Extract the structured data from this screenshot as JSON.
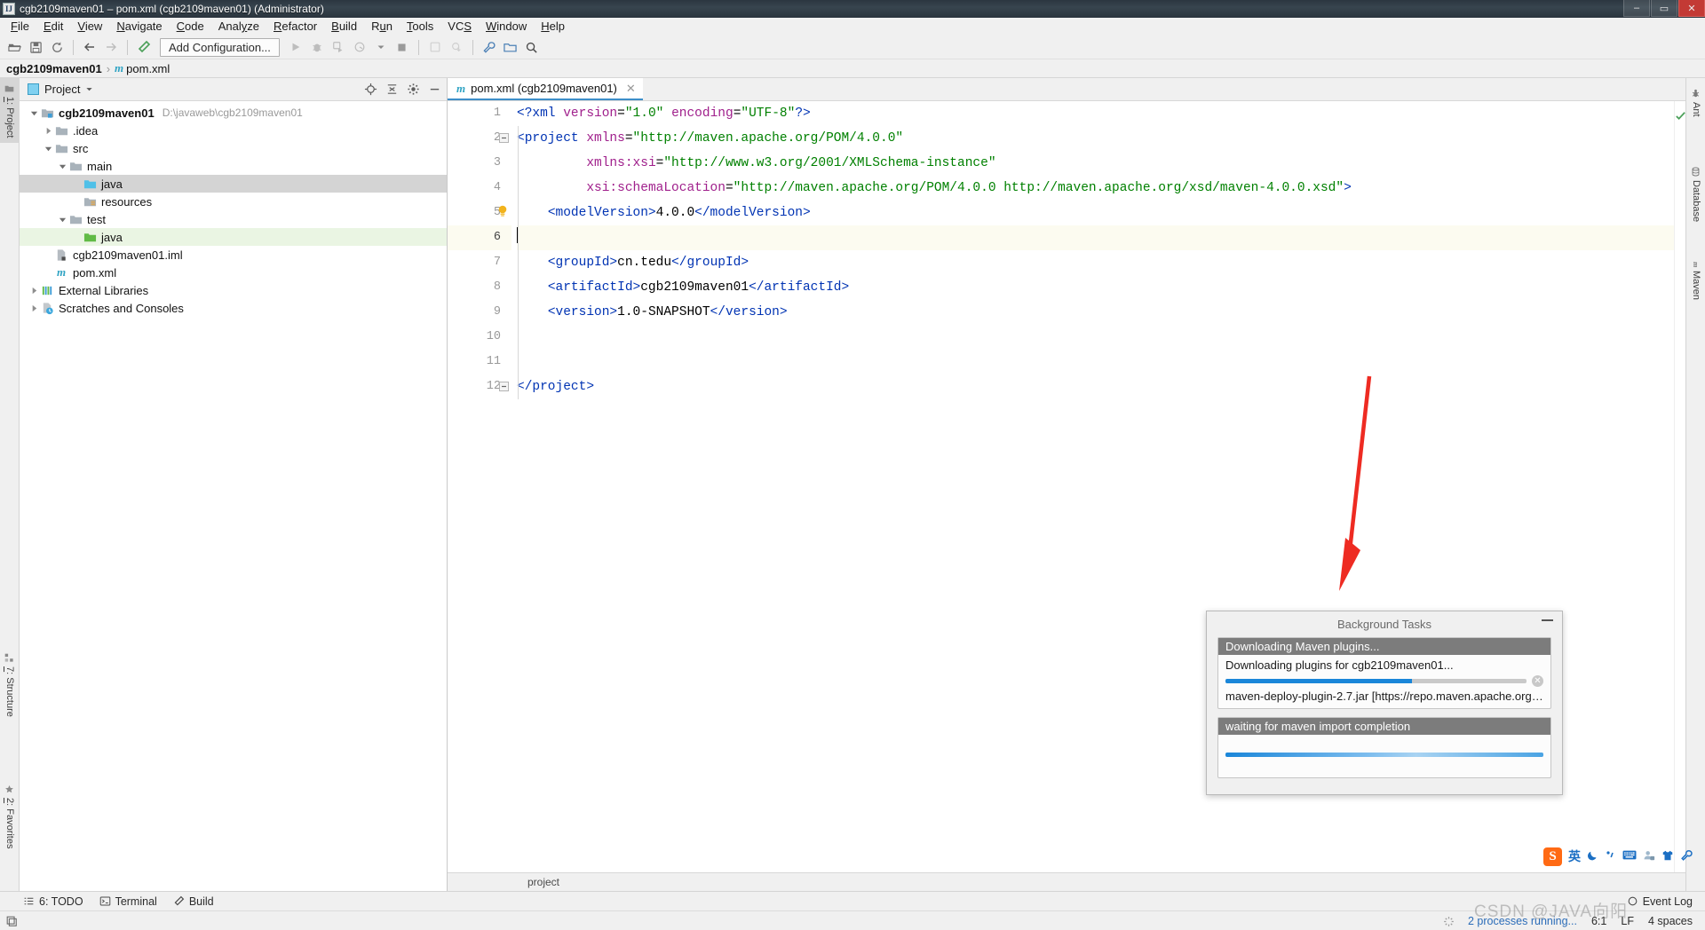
{
  "window": {
    "title": "cgb2109maven01 – pom.xml (cgb2109maven01) (Administrator)",
    "minimize": "–",
    "maximize": "▭",
    "close": "✕"
  },
  "menubar": {
    "items": [
      "File",
      "Edit",
      "View",
      "Navigate",
      "Code",
      "Analyze",
      "Refactor",
      "Build",
      "Run",
      "Tools",
      "VCS",
      "Window",
      "Help"
    ]
  },
  "toolbar": {
    "add_configuration": "Add Configuration...",
    "icons": [
      "open-folder-icon",
      "save-all-icon",
      "sync-icon",
      "back-arrow-icon",
      "forward-arrow-icon",
      "build-hammer-icon",
      "run-icon",
      "debug-icon",
      "run-with-coverage-icon",
      "profile-icon",
      "stop-icon",
      "update-project-icon",
      "commit-icon",
      "settings-wrench-icon",
      "project-structure-icon",
      "search-icon"
    ]
  },
  "navbar": {
    "project": "cgb2109maven01",
    "separator": "›",
    "file_icon": "m",
    "file": "pom.xml"
  },
  "left_tool_strip": {
    "tabs": [
      {
        "label": "1: Project",
        "icon": "project-folder-icon",
        "active": true
      },
      {
        "label": "7: Structure",
        "icon": "structure-icon",
        "active": false
      },
      {
        "label": "2: Favorites",
        "icon": "star-icon",
        "active": false
      }
    ]
  },
  "right_tool_strip": {
    "tabs": [
      {
        "label": "Ant",
        "icon": "ant-icon"
      },
      {
        "label": "Database",
        "icon": "database-icon"
      },
      {
        "label": "Maven",
        "icon": "maven-m-icon"
      }
    ]
  },
  "project_panel": {
    "header_label": "Project",
    "header_icons": [
      "locate-target-icon",
      "collapse-all-icon",
      "settings-gear-icon",
      "hide-minimize-icon"
    ],
    "tree": [
      {
        "label": "cgb2109maven01",
        "path": "D:\\javaweb\\cgb2109maven01",
        "depth": 0,
        "arrow": "down",
        "icon": "module-folder-icon",
        "bold": true,
        "state": "normal"
      },
      {
        "label": ".idea",
        "path": "",
        "depth": 1,
        "arrow": "right",
        "icon": "folder-icon",
        "bold": false,
        "state": "normal"
      },
      {
        "label": "src",
        "path": "",
        "depth": 1,
        "arrow": "down",
        "icon": "folder-icon",
        "bold": false,
        "state": "normal"
      },
      {
        "label": "main",
        "path": "",
        "depth": 2,
        "arrow": "down",
        "icon": "folder-icon",
        "bold": false,
        "state": "normal"
      },
      {
        "label": "java",
        "path": "",
        "depth": 3,
        "arrow": "none",
        "icon": "source-root-folder-icon",
        "bold": false,
        "state": "selected"
      },
      {
        "label": "resources",
        "path": "",
        "depth": 3,
        "arrow": "none",
        "icon": "resources-root-folder-icon",
        "bold": false,
        "state": "normal"
      },
      {
        "label": "test",
        "path": "",
        "depth": 2,
        "arrow": "down",
        "icon": "folder-icon",
        "bold": false,
        "state": "normal"
      },
      {
        "label": "java",
        "path": "",
        "depth": 3,
        "arrow": "none",
        "icon": "test-source-root-folder-icon",
        "bold": false,
        "state": "green"
      },
      {
        "label": "cgb2109maven01.iml",
        "path": "",
        "depth": 1,
        "arrow": "none",
        "icon": "iml-file-icon",
        "bold": false,
        "state": "normal"
      },
      {
        "label": "pom.xml",
        "path": "",
        "depth": 1,
        "arrow": "none",
        "icon": "maven-m-icon",
        "bold": false,
        "state": "normal"
      },
      {
        "label": "External Libraries",
        "path": "",
        "depth": 0,
        "arrow": "right",
        "icon": "libraries-icon",
        "bold": false,
        "state": "normal"
      },
      {
        "label": "Scratches and Consoles",
        "path": "",
        "depth": 0,
        "arrow": "right",
        "icon": "scratches-icon",
        "bold": false,
        "state": "normal"
      }
    ]
  },
  "editor": {
    "tab": {
      "icon": "m",
      "label": "pom.xml (cgb2109maven01)",
      "close": "✕"
    },
    "breadcrumb": "project",
    "cursor_line": 6,
    "line_numbers": [
      "1",
      "2",
      "3",
      "4",
      "5",
      "6",
      "7",
      "8",
      "9",
      "10",
      "11",
      "12"
    ],
    "code_lines": [
      {
        "n": 1,
        "segments": [
          {
            "t": "<?",
            "c": "pi"
          },
          {
            "t": "xml",
            "c": "tagn"
          },
          {
            "t": " ",
            "c": "plain"
          },
          {
            "t": "version",
            "c": "attr"
          },
          {
            "t": "=",
            "c": "plain"
          },
          {
            "t": "\"1.0\"",
            "c": "str"
          },
          {
            "t": " ",
            "c": "plain"
          },
          {
            "t": "encoding",
            "c": "attr"
          },
          {
            "t": "=",
            "c": "plain"
          },
          {
            "t": "\"UTF-8\"",
            "c": "str"
          },
          {
            "t": "?>",
            "c": "pi"
          }
        ]
      },
      {
        "n": 2,
        "segments": [
          {
            "t": "<",
            "c": "pi"
          },
          {
            "t": "project",
            "c": "tagn"
          },
          {
            "t": " ",
            "c": "plain"
          },
          {
            "t": "xmlns",
            "c": "attr"
          },
          {
            "t": "=",
            "c": "plain"
          },
          {
            "t": "\"http://maven.apache.org/POM/4.0.0\"",
            "c": "str"
          }
        ]
      },
      {
        "n": 3,
        "segments": [
          {
            "t": "         ",
            "c": "plain"
          },
          {
            "t": "xmlns:xsi",
            "c": "attr"
          },
          {
            "t": "=",
            "c": "plain"
          },
          {
            "t": "\"http://www.w3.org/2001/XMLSchema-instance\"",
            "c": "str"
          }
        ]
      },
      {
        "n": 4,
        "segments": [
          {
            "t": "         ",
            "c": "plain"
          },
          {
            "t": "xsi:schemaLocation",
            "c": "attr"
          },
          {
            "t": "=",
            "c": "plain"
          },
          {
            "t": "\"http://maven.apache.org/POM/4.0.0 http://maven.apache.org/xsd/maven-4.0.0.xsd\"",
            "c": "str"
          },
          {
            "t": ">",
            "c": "pi"
          }
        ]
      },
      {
        "n": 5,
        "segments": [
          {
            "t": "    ",
            "c": "plain"
          },
          {
            "t": "<modelVersion>",
            "c": "tagn"
          },
          {
            "t": "4.0.0",
            "c": "plain"
          },
          {
            "t": "</modelVersion>",
            "c": "tagn"
          }
        ]
      },
      {
        "n": 6,
        "segments": []
      },
      {
        "n": 7,
        "segments": [
          {
            "t": "    ",
            "c": "plain"
          },
          {
            "t": "<groupId>",
            "c": "tagn"
          },
          {
            "t": "cn.tedu",
            "c": "plain"
          },
          {
            "t": "</groupId>",
            "c": "tagn"
          }
        ]
      },
      {
        "n": 8,
        "segments": [
          {
            "t": "    ",
            "c": "plain"
          },
          {
            "t": "<artifactId>",
            "c": "tagn"
          },
          {
            "t": "cgb2109maven01",
            "c": "plain"
          },
          {
            "t": "</artifactId>",
            "c": "tagn"
          }
        ]
      },
      {
        "n": 9,
        "segments": [
          {
            "t": "    ",
            "c": "plain"
          },
          {
            "t": "<version>",
            "c": "tagn"
          },
          {
            "t": "1.0-SNAPSHOT",
            "c": "plain"
          },
          {
            "t": "</version>",
            "c": "tagn"
          }
        ]
      },
      {
        "n": 10,
        "segments": []
      },
      {
        "n": 11,
        "segments": []
      },
      {
        "n": 12,
        "segments": [
          {
            "t": "</project>",
            "c": "tagn"
          }
        ]
      }
    ],
    "inspection_status": "ok-checkmark"
  },
  "background_tasks": {
    "title": "Background Tasks",
    "minimize_icon": "minimize-icon",
    "tasks": [
      {
        "header": "Downloading Maven plugins...",
        "text": "Downloading plugins for cgb2109maven01...",
        "progress": 62,
        "indeterminate": false,
        "cancel_icon": "cancel-circle-icon",
        "subtext": "maven-deploy-plugin-2.7.jar [https://repo.maven.apache.org/..."
      },
      {
        "header": "waiting for maven import completion",
        "text": "",
        "progress": 100,
        "indeterminate": true,
        "cancel_icon": "",
        "subtext": ""
      }
    ]
  },
  "bottom_tool_bar": {
    "items": [
      {
        "label": "6: TODO",
        "icon": "todo-list-icon"
      },
      {
        "label": "Terminal",
        "icon": "terminal-icon"
      },
      {
        "label": "Build",
        "icon": "build-hammer-icon"
      }
    ],
    "event_log": {
      "label": "Event Log",
      "icon": "event-log-icon"
    }
  },
  "status_bar": {
    "processes": "2 processes running...",
    "caret_position": "6:1",
    "line_separator": "LF",
    "indent": "4 spaces",
    "spinner_icon": "spinner-icon"
  },
  "ime_toolbar": {
    "logo": "S",
    "items": [
      "英",
      "🌙",
      "✎",
      "⌨",
      "👤",
      "👕",
      "🔧"
    ]
  },
  "watermark": "CSDN @JAVA向阳",
  "colors": {
    "accent_blue": "#3d8ec9",
    "progress_blue": "#1a86d9",
    "tag_blue": "#0033b3",
    "string_green": "#008000",
    "attribute_magenta": "#a0208c",
    "selection_gray": "#d4d4d4",
    "test_root_green": "#eaf5e3",
    "current_line": "#fcfbf0",
    "arrow_red": "#ee2b22"
  }
}
